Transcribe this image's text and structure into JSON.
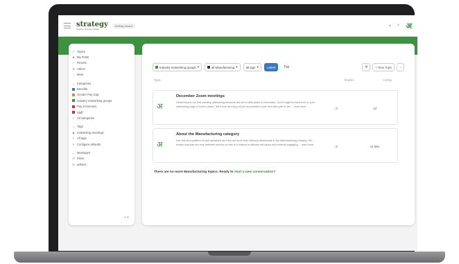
{
  "topbar": {
    "logo_name": "strategy",
    "logo_tag": "Smarter. Stronger. Better.",
    "pill": "Setting wizard"
  },
  "sidebar": {
    "nav": [
      {
        "icon": "≡",
        "label": "Topics"
      },
      {
        "icon": "♟",
        "label": "My Posts"
      },
      {
        "icon": "≡",
        "label": "Review"
      },
      {
        "icon": "⚒",
        "label": "Admin"
      },
      {
        "icon": "⋮",
        "label": "More"
      }
    ],
    "categories_header": "Categories",
    "categories": [
      {
        "label": "Benefits",
        "color": "#3a7bc8"
      },
      {
        "label": "Gender Pay Gap",
        "color": "#e08a2c"
      },
      {
        "label": "Industry networking groups",
        "color": "#3d9241"
      },
      {
        "label": "Pay & bonuses",
        "color": "#c83232"
      },
      {
        "label": "Staff",
        "color": "#c83232"
      }
    ],
    "all_categories": "All categories",
    "tags_header": "Tags",
    "tags": [
      {
        "icon": "◆",
        "label": "networking-meetings"
      },
      {
        "icon": "≡",
        "label": "All tags"
      },
      {
        "icon": "✎",
        "label": "Configure defaults"
      }
    ],
    "messages_header": "Messages",
    "messages": [
      {
        "icon": "✉",
        "label": "Inbox"
      },
      {
        "icon": "✉",
        "label": "admins"
      }
    ]
  },
  "filters": {
    "category": "Industry networking groups",
    "subcategory": "all Manufacturing",
    "tags": "all tags",
    "latest": "Latest",
    "top": "Top"
  },
  "actions": {
    "new_topic": "New Topic"
  },
  "table": {
    "col_topic": "Topic",
    "col_replies": "Replies",
    "col_activity": "Activity"
  },
  "topics": [
    {
      "title": "December Zoom meetings",
      "excerpt": "Hereeveyone our first industry networking sessions are set to take place in December. Don't forget to head over to your networking page to book a place. We'd love as many of you as possible to join and take part in the ... read more",
      "replies": "0",
      "activity": "1d"
    },
    {
      "title": "About the Manufacturing category",
      "excerpt": "Use this as a platform to ask questions and find out more from fellow professionals in the Manufacturing Industry. HR, reward and pay are very between sectors so this is a chance to discuss hot topics and network engaging ... read more",
      "replies": "0",
      "activity": "11 Mar"
    }
  ],
  "footer_msg": "There are no more Manufacturing topics. Ready to",
  "footer_link": "start a new conversation?",
  "colors": {
    "brand_green": "#3d9241",
    "accent_blue": "#3a77c5"
  }
}
